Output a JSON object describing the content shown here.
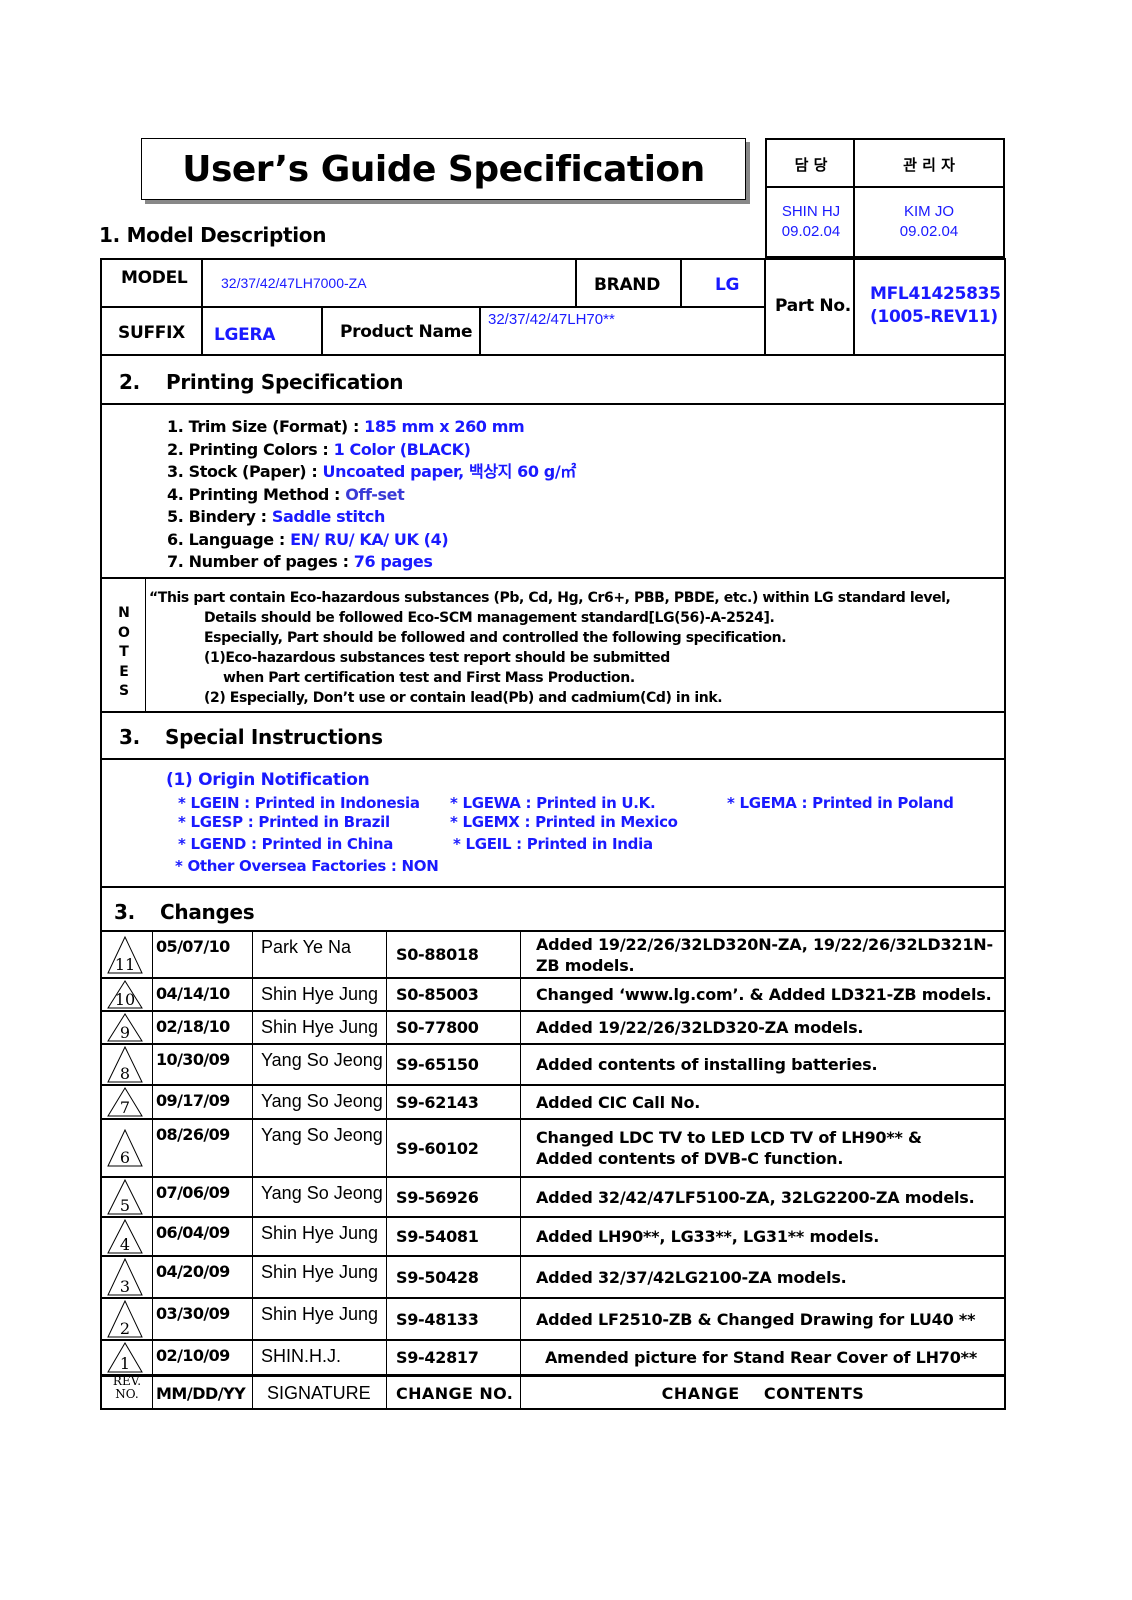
{
  "title": "User’s Guide Specification",
  "approval": {
    "headers": [
      "담 당",
      "관 리 자"
    ],
    "names": [
      {
        "name": "SHIN HJ",
        "date": "09.02.04"
      },
      {
        "name": "KIM JO",
        "date": "09.02.04"
      }
    ]
  },
  "model_description": {
    "heading": "1. Model Description",
    "model_label": "MODEL",
    "model_value": "32/37/42/47LH7000-ZA",
    "brand_label": "BRAND",
    "brand_value": "LG",
    "suffix_label": "SUFFIX",
    "suffix_value": "LGERA",
    "product_name_label": "Product Name",
    "product_name_value": "32/37/42/47LH70**",
    "part_no_label": "Part No.",
    "part_no_value": "MFL41425835",
    "part_no_rev": "(1005-REV11)"
  },
  "printing_spec": {
    "number": "2.",
    "heading": "Printing Specification",
    "items": [
      {
        "label": "1. Trim Size (Format) : ",
        "value": "185 mm x 260 mm"
      },
      {
        "label": "2. Printing Colors : ",
        "value": "1 Color (BLACK)"
      },
      {
        "label": "3. Stock (Paper) : ",
        "value": "Uncoated paper, 백상지 60 g/㎡"
      },
      {
        "label": "4. Printing Method : ",
        "value": "Off-set"
      },
      {
        "label": "5. Bindery  : ",
        "value": "Saddle stitch"
      },
      {
        "label": "6. Language : ",
        "value": "EN/ RU/ KA/ UK (4)"
      },
      {
        "label": "7. Number of pages : ",
        "value": "76 pages"
      }
    ]
  },
  "notes": {
    "side_label": [
      "N",
      "O",
      "T",
      "E",
      "S"
    ],
    "lines": [
      "“This part contain Eco-hazardous substances (Pb, Cd, Hg, Cr6+, PBB, PBDE, etc.) within LG standard level,",
      "Details should be followed Eco-SCM management standard[LG(56)-A-2524].",
      "Especially, Part should be followed and controlled the following specification.",
      "(1)Eco-hazardous substances test report should be submitted",
      "when  Part certification test and First Mass Production.",
      "(2) Especially, Don’t use or contain lead(Pb) and cadmium(Cd) in ink."
    ]
  },
  "special_instructions": {
    "number": "3.",
    "heading": "Special Instructions",
    "subheading": "(1) Origin Notification",
    "origins": [
      "* LGEIN : Printed in Indonesia",
      "* LGEWA : Printed in U.K.",
      "* LGEMA : Printed in Poland",
      "* LGESP : Printed in Brazil",
      "* LGEMX : Printed in Mexico",
      "* LGEND : Printed in China",
      "* LGEIL : Printed in India",
      "* Other Oversea Factories : NON"
    ]
  },
  "changes": {
    "number": "3.",
    "heading": "Changes",
    "rows": [
      {
        "rev": "11",
        "date": "05/07/10",
        "signature": "Park Ye Na",
        "change_no": "S0-88018",
        "contents": [
          "Added 19/22/26/32LD320N-ZA, 19/22/26/32LD321N-",
          "ZB models."
        ]
      },
      {
        "rev": "10",
        "date": "04/14/10",
        "signature": "Shin Hye Jung",
        "change_no": "S0-85003",
        "contents": [
          "Changed ‘www.lg.com’. & Added LD321-ZB models."
        ]
      },
      {
        "rev": "9",
        "date": "02/18/10",
        "signature": "Shin Hye Jung",
        "change_no": "S0-77800",
        "contents": [
          "Added 19/22/26/32LD320-ZA models."
        ]
      },
      {
        "rev": "8",
        "date": "10/30/09",
        "signature": "Yang So Jeong",
        "change_no": "S9-65150",
        "contents": [
          "Added contents of installing batteries."
        ]
      },
      {
        "rev": "7",
        "date": "09/17/09",
        "signature": "Yang So Jeong",
        "change_no": "S9-62143",
        "contents": [
          "Added CIC Call No."
        ]
      },
      {
        "rev": "6",
        "date": "08/26/09",
        "signature": "Yang So Jeong",
        "change_no": "S9-60102",
        "contents": [
          "Changed LDC TV to LED LCD TV of LH90** &",
          "Added contents of DVB-C function."
        ]
      },
      {
        "rev": "5",
        "date": "07/06/09",
        "signature": "Yang So Jeong",
        "change_no": "S9-56926",
        "contents": [
          "Added 32/42/47LF5100-ZA, 32LG2200-ZA models."
        ]
      },
      {
        "rev": "4",
        "date": "06/04/09",
        "signature": "Shin Hye Jung",
        "change_no": "S9-54081",
        "contents": [
          "Added LH90**, LG33**, LG31** models."
        ]
      },
      {
        "rev": "3",
        "date": "04/20/09",
        "signature": "Shin Hye Jung",
        "change_no": "S9-50428",
        "contents": [
          "Added 32/37/42LG2100-ZA models."
        ]
      },
      {
        "rev": "2",
        "date": "03/30/09",
        "signature": "Shin Hye Jung",
        "change_no": "S9-48133",
        "contents": [
          "Added LF2510-ZB & Changed Drawing for LU40 **"
        ]
      },
      {
        "rev": "1",
        "date": "02/10/09",
        "signature": "SHIN.H.J.",
        "change_no": "S9-42817",
        "contents": [
          "Amended picture for Stand Rear Cover of LH70**"
        ]
      }
    ],
    "footer": {
      "rev": "REV.",
      "rev2": "NO.",
      "date": "MM/DD/YY",
      "signature": "SIGNATURE",
      "change_no": "CHANGE NO.",
      "contents": "CHANGE    CONTENTS"
    }
  }
}
